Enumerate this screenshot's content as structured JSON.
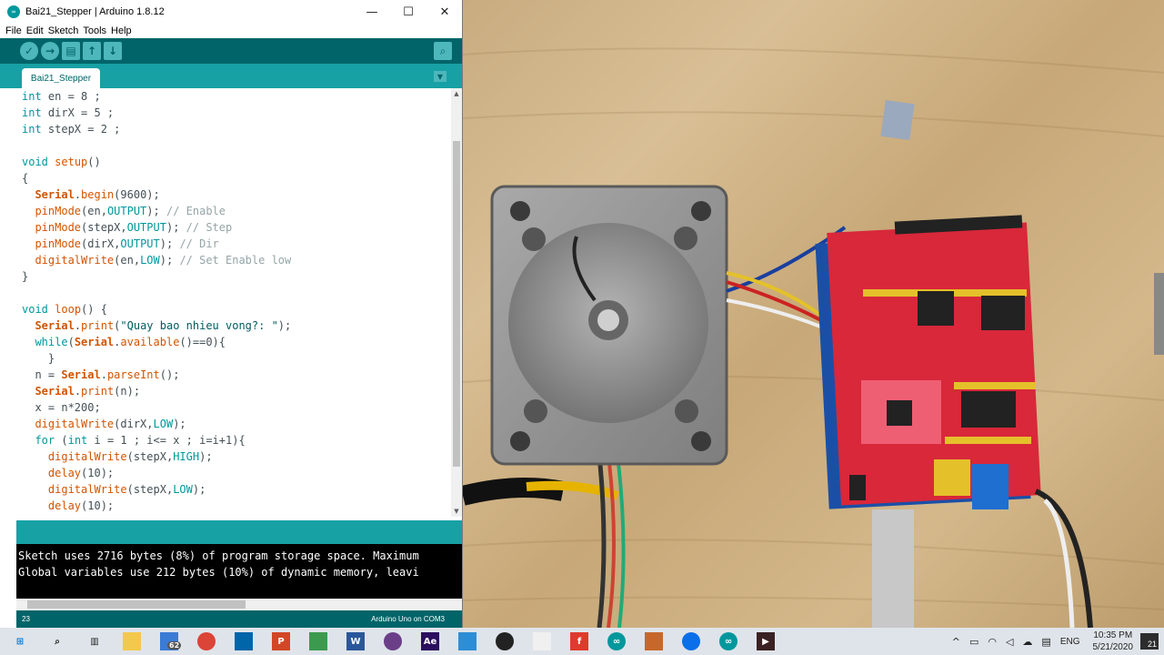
{
  "window": {
    "title": "Bai21_Stepper | Arduino 1.8.12",
    "minimize": "—",
    "maximize": "☐",
    "close": "✕"
  },
  "menu": [
    "File",
    "Edit",
    "Sketch",
    "Tools",
    "Help"
  ],
  "toolbar": {
    "verify_icon": "check-icon",
    "upload_icon": "arrow-right-icon",
    "new_icon": "file-icon",
    "open_icon": "arrow-up-icon",
    "save_icon": "arrow-down-icon",
    "serial_monitor_icon": "magnifier-icon"
  },
  "tab": {
    "label": "Bai21_Stepper"
  },
  "code_lines": [
    "int en = 8 ;",
    "int dirX = 5 ;",
    "int stepX = 2 ;",
    "",
    "void setup()",
    "{",
    "  Serial.begin(9600);",
    "  pinMode(en,OUTPUT); // Enable",
    "  pinMode(stepX,OUTPUT); // Step",
    "  pinMode(dirX,OUTPUT); // Dir",
    "  digitalWrite(en,LOW); // Set Enable low",
    "}",
    "",
    "void loop() {",
    "  Serial.print(\"Quay bao nhieu vong?: \");",
    "  while(Serial.available()==0){",
    "    }",
    "  n = Serial.parseInt();",
    "  Serial.print(n);",
    "  x = n*200;",
    "  digitalWrite(dirX,LOW);",
    "  for (int i = 1 ; i<= x ; i=i+1){",
    "    digitalWrite(stepX,HIGH);",
    "    delay(10);",
    "    digitalWrite(stepX,LOW);",
    "    delay(10);"
  ],
  "console": {
    "line1": "Sketch uses 2716 bytes (8%) of program storage space. Maximum",
    "line2": "Global variables use 212 bytes (10%) of dynamic memory, leavi"
  },
  "footer": {
    "line_number": "23",
    "board": "Arduino Uno on COM3"
  },
  "taskbar": {
    "apps": [
      "windows-start-icon",
      "search-icon",
      "task-view-icon",
      "file-explorer-icon",
      "mail-icon",
      "chrome-icon",
      "vscode-icon",
      "powerpoint-icon",
      "app-icon",
      "word-icon",
      "slack-icon",
      "after-effects-icon",
      "app-icon",
      "record-icon",
      "notes-icon",
      "foxit-icon",
      "arduino-icon",
      "app-icon",
      "zalo-icon",
      "arduino-icon",
      "media-icon"
    ],
    "mail_badge": "62",
    "lang": "ENG",
    "time": "10:35 PM",
    "date": "5/21/2020",
    "notifications": "21"
  }
}
